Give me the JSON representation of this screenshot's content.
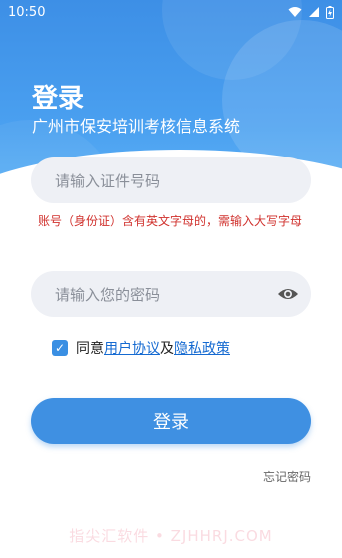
{
  "status_bar": {
    "time": "10:50"
  },
  "header": {
    "title": "登录",
    "subtitle": "广州市保安培训考核信息系统"
  },
  "form": {
    "id_input_placeholder": "请输入证件号码",
    "warning": "账号（身份证）含有英文字母的，需输入大写字母",
    "password_placeholder": "请输入您的密码",
    "agree_prefix": "同意",
    "user_agreement": "用户协议",
    "and_text": "及",
    "privacy_policy": "隐私政策",
    "agree_checked": true,
    "login_button": "登录",
    "forgot_password": "忘记密码"
  },
  "watermark": "指尖汇软件 • ZJHHRJ.COM",
  "colors": {
    "primary": "#3f90e2",
    "warning": "#d0312d",
    "link": "#156ad1"
  }
}
